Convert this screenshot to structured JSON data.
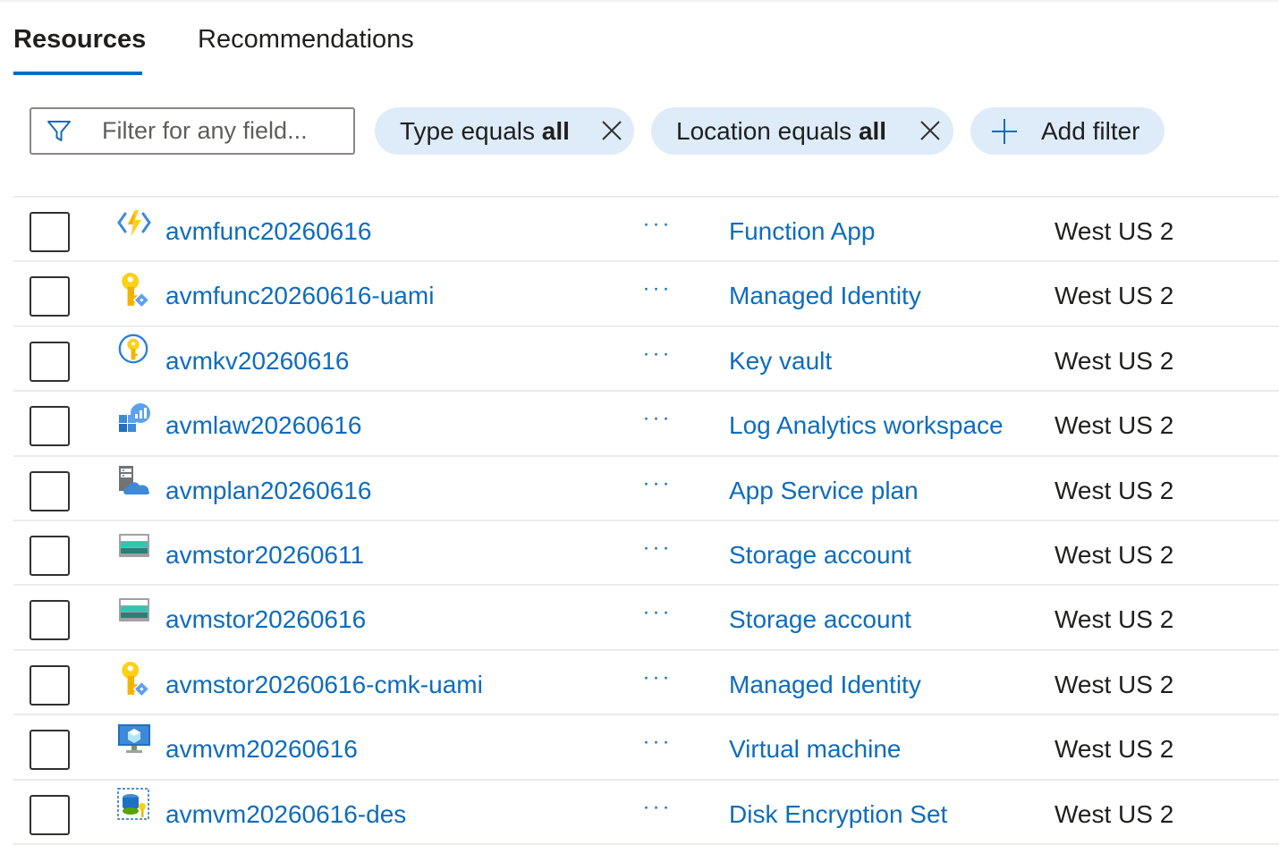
{
  "tabs": [
    {
      "label": "Resources",
      "active": true
    },
    {
      "label": "Recommendations",
      "active": false
    }
  ],
  "filter": {
    "placeholder": "Filter for any field...",
    "pills": [
      {
        "prefix": "Type equals ",
        "value": "all"
      },
      {
        "prefix": "Location equals ",
        "value": "all"
      }
    ],
    "add_filter_label": "Add filter"
  },
  "more_label": "···",
  "rows": [
    {
      "name": "avmfunc20260616",
      "type": "Function App",
      "location": "West US 2",
      "icon": "function-app-icon"
    },
    {
      "name": "avmfunc20260616-uami",
      "type": "Managed Identity",
      "location": "West US 2",
      "icon": "managed-identity-icon"
    },
    {
      "name": "avmkv20260616",
      "type": "Key vault",
      "location": "West US 2",
      "icon": "key-vault-icon"
    },
    {
      "name": "avmlaw20260616",
      "type": "Log Analytics workspace",
      "location": "West US 2",
      "icon": "log-analytics-icon"
    },
    {
      "name": "avmplan20260616",
      "type": "App Service plan",
      "location": "West US 2",
      "icon": "app-service-plan-icon"
    },
    {
      "name": "avmstor20260611",
      "type": "Storage account",
      "location": "West US 2",
      "icon": "storage-account-icon"
    },
    {
      "name": "avmstor20260616",
      "type": "Storage account",
      "location": "West US 2",
      "icon": "storage-account-icon"
    },
    {
      "name": "avmstor20260616-cmk-uami",
      "type": "Managed Identity",
      "location": "West US 2",
      "icon": "managed-identity-icon"
    },
    {
      "name": "avmvm20260616",
      "type": "Virtual machine",
      "location": "West US 2",
      "icon": "virtual-machine-icon"
    },
    {
      "name": "avmvm20260616-des",
      "type": "Disk Encryption Set",
      "location": "West US 2",
      "icon": "disk-encryption-set-icon"
    }
  ],
  "colors": {
    "accent": "#0f6cbd",
    "pill_bg": "#deecf9",
    "divider": "#edebe9"
  }
}
